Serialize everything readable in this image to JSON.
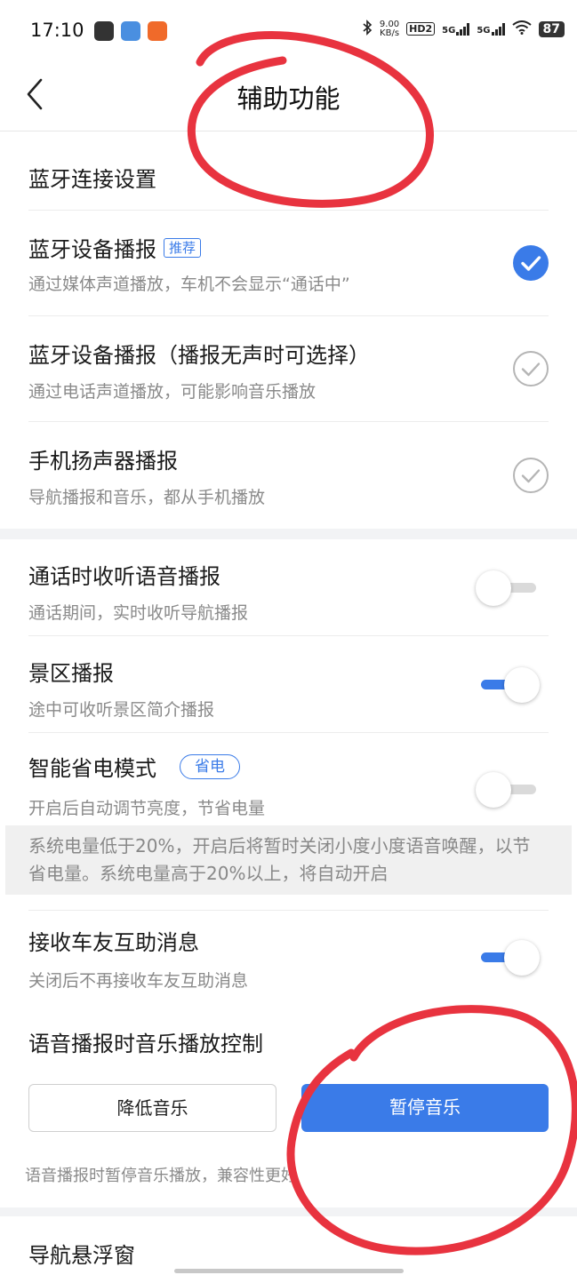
{
  "status_bar": {
    "time": "17:10",
    "net_speed_value": "9.00",
    "net_speed_unit": "KB/s",
    "hd_label": "HD2",
    "sim1_label": "5G",
    "sim2_label": "5G",
    "battery": "87"
  },
  "header": {
    "title": "辅助功能",
    "back_icon": "chevron-left-icon"
  },
  "bluetooth_section": {
    "heading": "蓝牙连接设置",
    "options": [
      {
        "title": "蓝牙设备播报",
        "tag": "推荐",
        "subtitle": "通过媒体声道播放，车机不会显示“通话中”",
        "selected": true
      },
      {
        "title": "蓝牙设备播报（播报无声时可选择）",
        "subtitle": "通过电话声道播放，可能影响音乐播放",
        "selected": false
      },
      {
        "title": "手机扬声器播报",
        "subtitle": "导航播报和音乐，都从手机播放",
        "selected": false
      }
    ]
  },
  "toggles": [
    {
      "title": "通话时收听语音播报",
      "subtitle": "通话期间，实时收听导航播报",
      "on": false
    },
    {
      "title": "景区播报",
      "subtitle": "途中可收听景区简介播报",
      "on": true
    },
    {
      "title": "智能省电模式",
      "tag": "省电",
      "subtitle": "开启后自动调节亮度，节省电量",
      "on": false
    },
    {
      "title": "接收车友互助消息",
      "subtitle": "关闭后不再接收车友互助消息",
      "on": true
    }
  ],
  "power_note": "系统电量低于20%，开启后将暂时关闭小度小度语音唤醒，以节省电量。系统电量高于20%以上，将自动开启",
  "music_control": {
    "heading": "语音播报时音乐播放控制",
    "lower_label": "降低音乐",
    "pause_label": "暂停音乐",
    "selected": "pause",
    "footnote": "语音播报时暂停音乐播放，兼容性更好"
  },
  "floating_window": {
    "title": "导航悬浮窗"
  },
  "colors": {
    "accent": "#3a7be8",
    "annotation": "#e8333f"
  }
}
